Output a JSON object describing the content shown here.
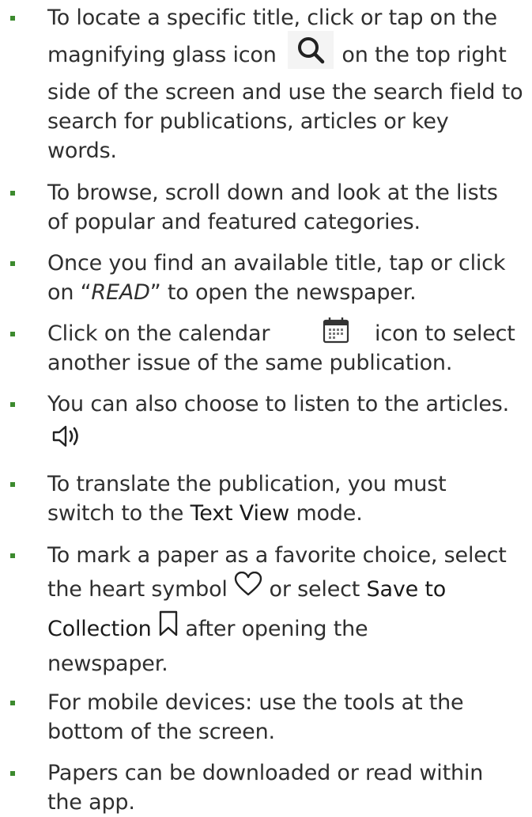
{
  "items": [
    {
      "lines": [
        "To locate a specific title, click or tap on the",
        "magnifying glass icon",
        "on the top right",
        "side of the screen and use the search field to",
        "search for publications, articles or key",
        "words."
      ]
    },
    {
      "lines": [
        "To browse, scroll down and look at the lists",
        "of popular and featured categories."
      ]
    },
    {
      "lines": [
        "Once you find an available title, tap or click",
        "on “",
        "READ",
        "” to open the newspaper."
      ]
    },
    {
      "lines": [
        "Click on the calendar",
        "icon to select",
        "another issue of the same publication."
      ]
    },
    {
      "lines": [
        "You can also choose to listen to the articles."
      ]
    },
    {
      "lines": [
        "To translate the publication, you must",
        "switch to the",
        "Text View",
        "mode."
      ]
    },
    {
      "lines": [
        "To mark a paper as a favorite choice, select",
        "the heart symbol",
        "or select",
        "Save to",
        "Collection",
        "after opening the",
        "newspaper."
      ]
    },
    {
      "lines": [
        "For mobile devices: use the tools at the",
        "bottom of the screen."
      ]
    },
    {
      "lines": [
        "Papers can be downloaded or read within",
        "the app."
      ]
    }
  ],
  "icons": {
    "search": "magnifying-glass-icon",
    "calendar": "calendar-icon",
    "speaker": "speaker-icon",
    "heart": "heart-icon",
    "bookmark": "bookmark-icon"
  },
  "colors": {
    "bullet": "#3c8a2e",
    "text": "#2f2f2f"
  }
}
